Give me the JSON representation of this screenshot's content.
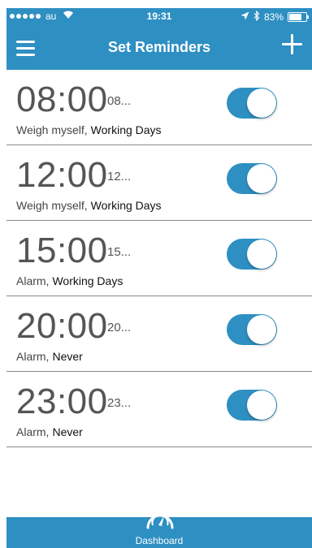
{
  "status_bar": {
    "carrier": "au",
    "time": "19:31",
    "battery_text": "83%",
    "battery_level": 0.83
  },
  "nav": {
    "title": "Set Reminders",
    "menu_icon": "hamburger-menu-icon",
    "add_icon": "plus-icon"
  },
  "reminders": [
    {
      "time": "08:00",
      "time_short": "08...",
      "label": "Weigh myself,",
      "repeat": "Working Days",
      "enabled": true
    },
    {
      "time": "12:00",
      "time_short": "12...",
      "label": "Weigh myself,",
      "repeat": "Working Days",
      "enabled": true
    },
    {
      "time": "15:00",
      "time_short": "15...",
      "label": "Alarm,",
      "repeat": "Working Days",
      "enabled": true
    },
    {
      "time": "20:00",
      "time_short": "20...",
      "label": "Alarm,",
      "repeat": "Never",
      "enabled": true
    },
    {
      "time": "23:00",
      "time_short": "23...",
      "label": "Alarm,",
      "repeat": "Never",
      "enabled": true
    }
  ],
  "tabbar": {
    "dashboard_label": "Dashboard",
    "dashboard_icon": "gauge-icon"
  },
  "colors": {
    "accent": "#2e8fc2",
    "divider": "#8a8a8a"
  }
}
